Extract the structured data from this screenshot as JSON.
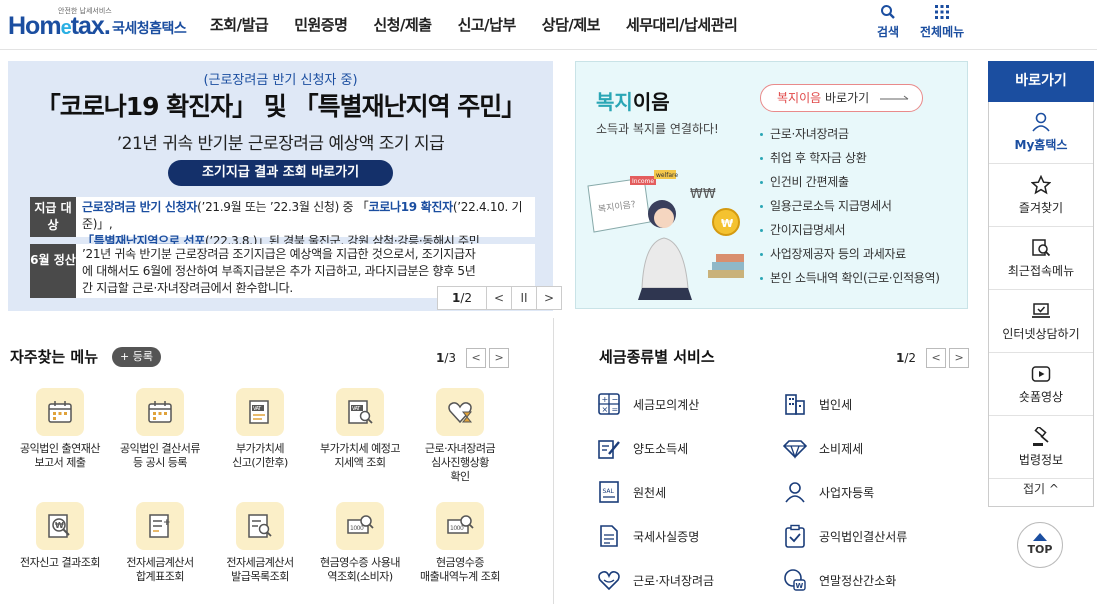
{
  "header": {
    "logo_small": "안전한 납세서비스",
    "logo_main_a": "Hom",
    "logo_main_e": "e",
    "logo_main_b": "tax.",
    "logo_sub": "국세청홈택스",
    "nav": [
      "조회/발급",
      "민원증명",
      "신청/제출",
      "신고/납부",
      "상담/제보",
      "세무대리/납세관리"
    ],
    "search_label": "검색",
    "menu_label": "전체메뉴",
    "accent": "#1b4ea0"
  },
  "banner": {
    "pre": "(근로장려금 반기 신청자 중)",
    "title": "「코로나19 확진자」 및 「특별재난지역 주민」",
    "subtitle": "’21년 귀속 반기분 근로장려금 예상액 조기 지급",
    "button": "조기지급 결과 조회 바로가기",
    "row1_tag": "지급 대상",
    "row1_text_a": "근로장려금 반기 신청자",
    "row1_text_b": "(’21.9월 또는 ’22.3월 신청) 중 「",
    "row1_text_c": "코로나19 확진자",
    "row1_text_d": "(’22.4.10. 기준)」,",
    "row1_text_e": "「특별재난지역으로 선포",
    "row1_text_f": "(’22.3.8.)」된 경북 울진군, 강원 삼척·강릉·동해시 주민",
    "row2_tag": "6월 정산",
    "row2_text": "’21년 귀속 반기분 근로장려금 조기지급은 예상액을 지급한 것으로서, 조기지급자에 대해서도 6월에 정산하여 부족지급분은 추가 지급하고, 과다지급분은 향후 5년간 지급할 근로·자녀장려금에서 환수합니다.",
    "page_current": "1",
    "page_total": "/2"
  },
  "welfare": {
    "title_a": "복지",
    "title_b": "이음",
    "subtitle": "소득과 복지를 연결하다!",
    "link_a": "복지이음",
    "link_b": " 바로가기",
    "items": [
      "근로·자녀장려금",
      "취업 후 학자금 상환",
      "인건비 간편제출",
      "일용근로소득 지급명세서",
      "간이지급명세서",
      "사업장제공자 등의 과세자료",
      "본인 소득내역 확인(근로·인적용역)"
    ],
    "illus_board": "복지이음?",
    "illus_tag1": "Income",
    "illus_tag2": "welfare"
  },
  "quick": {
    "title": "바로가기",
    "items": [
      "My홈택스",
      "즐겨찾기",
      "최근접속메뉴",
      "인터넷상담하기",
      "숏폼영상",
      "법령정보"
    ],
    "fold": "접기 ^",
    "top": "TOP"
  },
  "frequent": {
    "title": "자주찾는 메뉴",
    "add": "+ 등록",
    "page_current": "1",
    "page_total": "/3",
    "items": [
      [
        "공익법인 출연재산",
        "보고서 제출"
      ],
      [
        "공익법인 결산서류",
        "등 공시 등록"
      ],
      [
        "부가가치세",
        "신고(기한후)"
      ],
      [
        "부가가치세 예정고",
        "지세액 조회"
      ],
      [
        "근로·자녀장려금",
        "심사진행상황",
        "확인"
      ],
      [
        "전자신고 결과조회"
      ],
      [
        "전자세금계산서",
        "합계표조회"
      ],
      [
        "전자세금계산서",
        "발급목록조회"
      ],
      [
        "현금영수증 사용내",
        "역조회(소비자)"
      ],
      [
        "현금영수증",
        "매출내역누계 조회"
      ]
    ]
  },
  "taxservice": {
    "title": "세금종류별 서비스",
    "page_current": "1",
    "page_total": "/2",
    "items": [
      "세금모의계산",
      "법인세",
      "양도소득세",
      "소비제세",
      "원천세",
      "사업자등록",
      "국세사실증명",
      "공익법인결산서류",
      "근로·자녀장려금",
      "연말정산간소화"
    ]
  }
}
